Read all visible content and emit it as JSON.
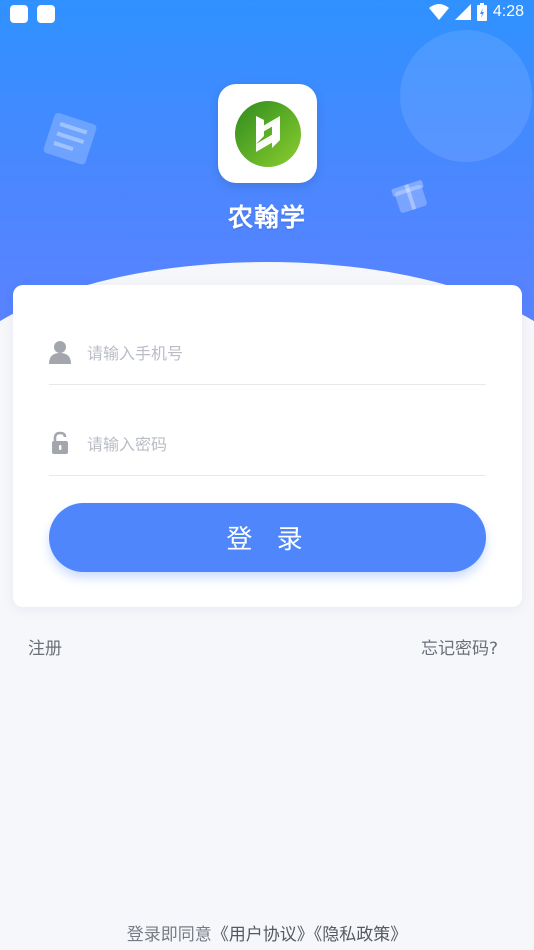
{
  "status_bar": {
    "time": "4:28"
  },
  "app": {
    "name": "农翰学"
  },
  "form": {
    "phone_placeholder": "请输入手机号",
    "phone_value": "",
    "password_placeholder": "请输入密码",
    "password_value": "",
    "login_label": "登 录"
  },
  "links": {
    "register": "注册",
    "forgot": "忘记密码?"
  },
  "agreement": {
    "prefix": "登录即同意",
    "user_agreement": "《用户协议》",
    "privacy_policy": "《隐私政策》"
  },
  "colors": {
    "primary": "#4f86fb",
    "hero_top": "#2f91ff",
    "background": "#f6f7fa",
    "logo_green": "#4caf2a"
  }
}
